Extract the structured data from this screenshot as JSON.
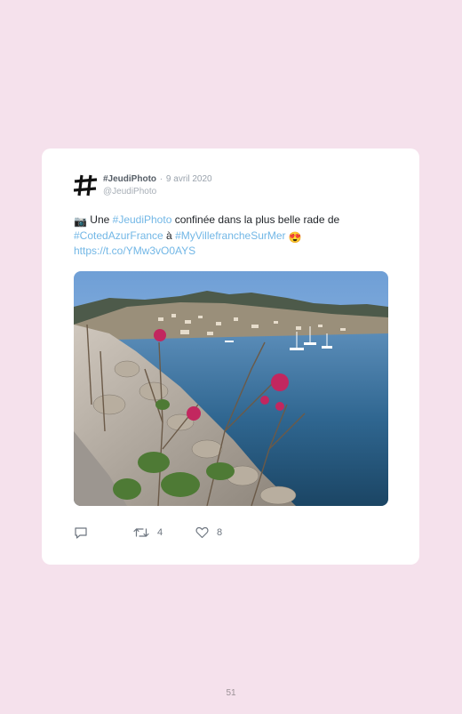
{
  "tweet": {
    "author_name": "#JeudiPhoto",
    "separator": "·",
    "date": "9 avril 2020",
    "handle": "@JeudiPhoto",
    "text_parts": {
      "camera_emoji": "📷",
      "t1": " Une ",
      "tag1": "#JeudiPhoto",
      "t2": " confinée dans la plus belle rade de ",
      "tag2": "#CotedAzurFrance",
      "t3": " à ",
      "tag3": "#MyVillefrancheSurMer",
      "heart_eyes_emoji": "😍",
      "url": "https://t.co/YMw3vO0AYS"
    },
    "image_icon": "photo-villefranche-bay"
  },
  "actions": {
    "reply_icon": "comment-icon",
    "retweet_icon": "retweet-icon",
    "retweet_count": "4",
    "like_icon": "heart-icon",
    "like_count": "8"
  },
  "page_number": "51",
  "colors": {
    "page_background": "#f5e1ec",
    "card_background": "#ffffff",
    "link": "#72b7e6",
    "text": "#1f2328"
  }
}
